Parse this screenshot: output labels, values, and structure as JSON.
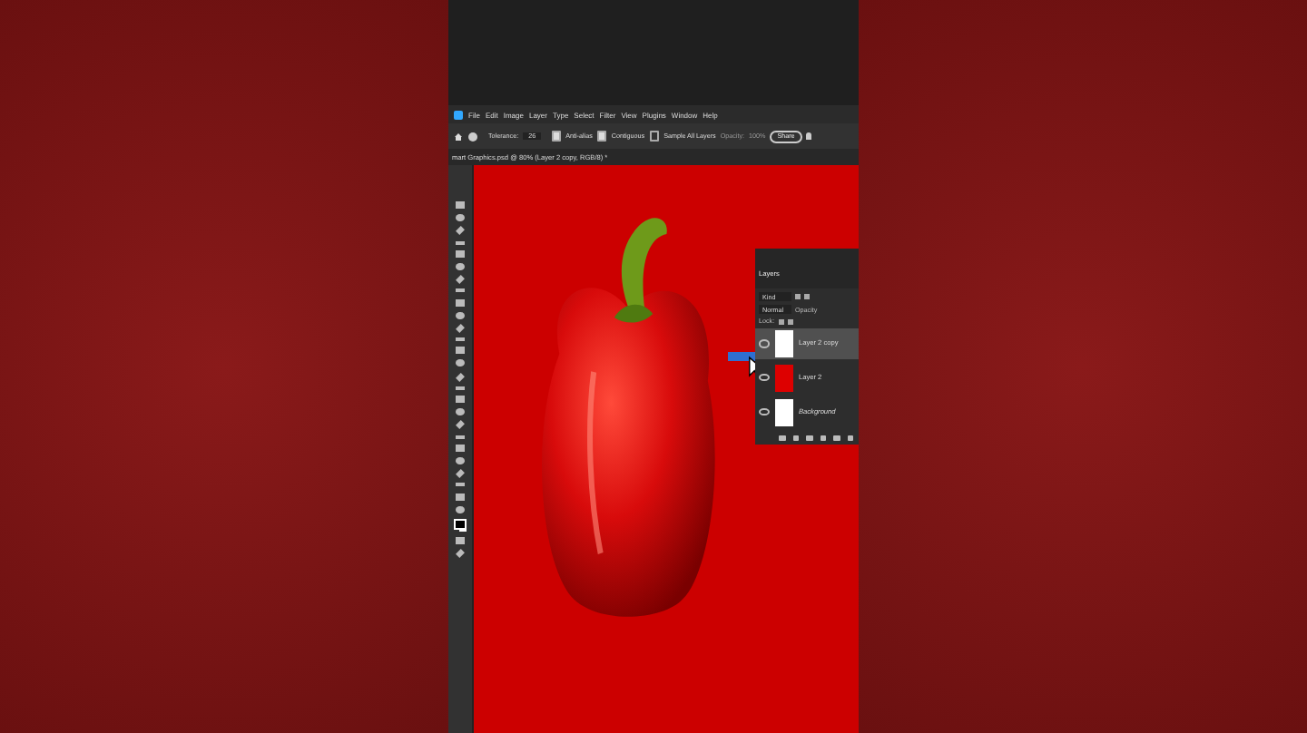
{
  "menu": [
    "File",
    "Edit",
    "Image",
    "Layer",
    "Type",
    "Select",
    "Filter",
    "View",
    "Plugins",
    "Window",
    "Help"
  ],
  "options": {
    "tolerance_label": "Tolerance:",
    "tolerance": "26",
    "anti_alias": {
      "label": "Anti-alias",
      "checked": true
    },
    "contiguous": {
      "label": "Contiguous",
      "checked": true
    },
    "sample_all": {
      "label": "Sample All Layers",
      "checked": false
    },
    "opacity_label": "Opacity:",
    "opacity": "100%",
    "share": "Share"
  },
  "document_tab": "mart Graphics.psd @ 80% (Layer 2 copy, RGB/8) *",
  "layers_panel": {
    "title": "Layers",
    "filter": "Kind",
    "blend_mode": "Normal",
    "opacity_label": "Opacity",
    "lock_label": "Lock:",
    "layers": [
      {
        "name": "Layer 2 copy",
        "selected": true,
        "kind": "white"
      },
      {
        "name": "Layer 2",
        "selected": false,
        "kind": "pepper"
      },
      {
        "name": "Background",
        "selected": false,
        "kind": "white"
      }
    ]
  }
}
